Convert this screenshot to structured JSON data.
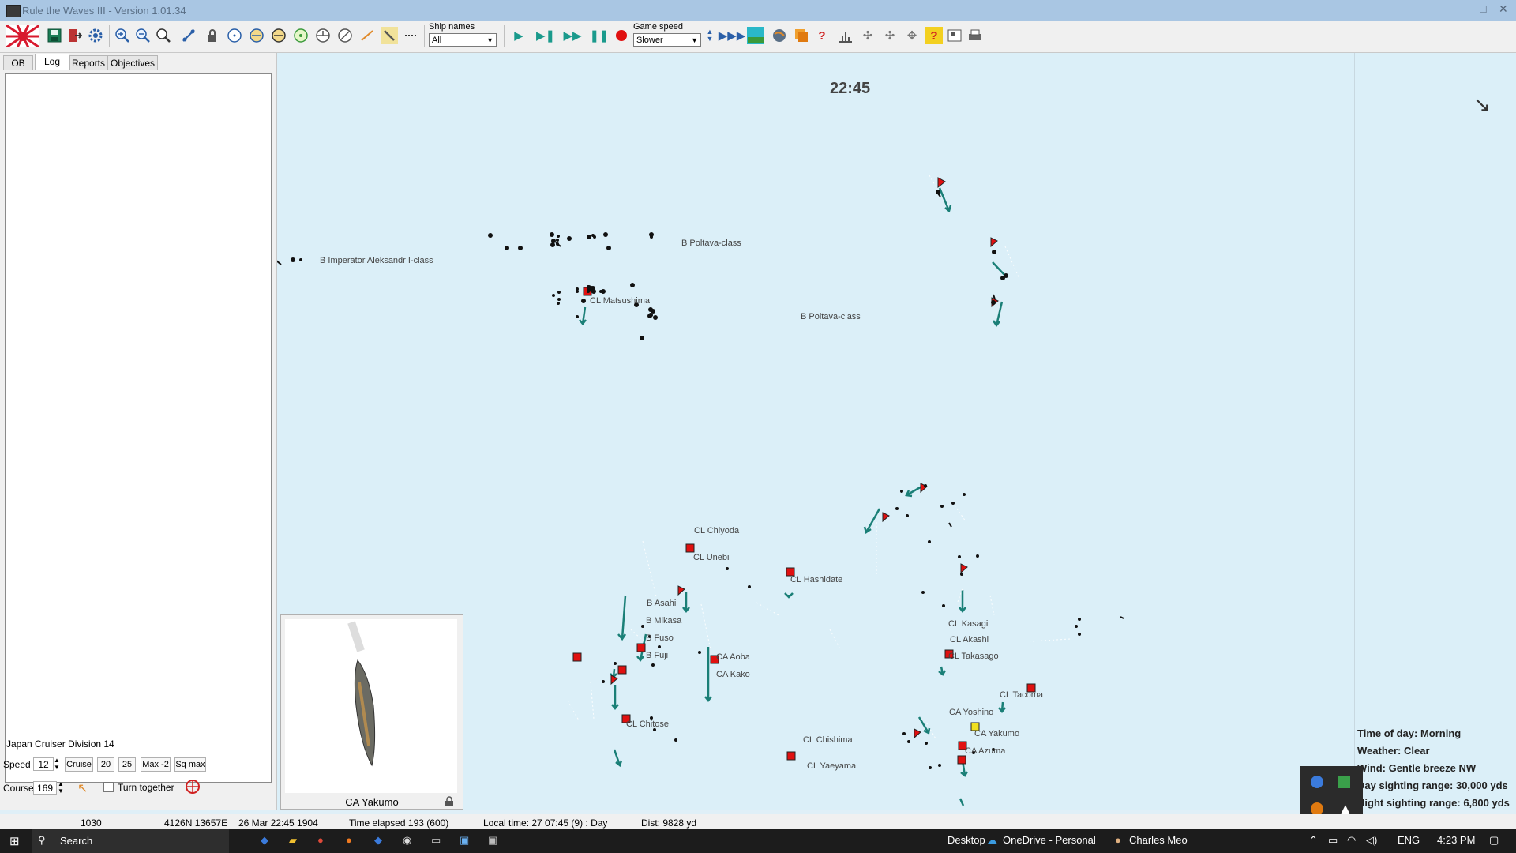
{
  "window": {
    "title": "Rule the Waves III - Version 1.01.34",
    "minimize_glyph": "□",
    "close_glyph": "✕"
  },
  "toolbar": {
    "icons": [
      "flag-japan-icon",
      "save-icon",
      "exit-icon",
      "gear-icon",
      "zoom-in-icon",
      "zoom-out-icon",
      "zoom-fit-icon",
      "link-icon",
      "lock-icon",
      "compass-icon",
      "range-ring-icon",
      "minus-ring-icon",
      "target-ring-icon",
      "cross-ring-icon",
      "slash-ring-icon",
      "line-icon",
      "pencil-icon",
      "dots-icon"
    ],
    "ship_names_label": "Ship names",
    "ship_names_value": "All",
    "game_speed_label": "Game speed",
    "game_speed_value": "Slower",
    "play_icons": [
      "play-icon",
      "step-icon",
      "fast-forward-icon",
      "pause-icon",
      "record-icon"
    ],
    "right_icons": [
      "fast-icon",
      "map-icon",
      "globe-icon",
      "layers-icon",
      "help-report-icon",
      "chart-icon",
      "formation-icon",
      "formation2-icon",
      "formation3-icon",
      "help-icon",
      "notes-icon",
      "print-icon"
    ],
    "accent_color": "#1a9a8c"
  },
  "left_panel": {
    "tabs": [
      "OB",
      "Log",
      "Reports",
      "Objectives"
    ],
    "active_tab": "Log",
    "division": "Japan Cruiser Division 14",
    "speed_label": "Speed",
    "speed_value": "12",
    "speed_buttons": [
      "Cruise",
      "20",
      "25",
      "Max -2",
      "Sq max"
    ],
    "course_label": "Course",
    "course_value": "169",
    "turn_together": "Turn together"
  },
  "ship_panel": {
    "ship_name": "CA Yakumo"
  },
  "map": {
    "time": "22:45",
    "labels": [
      {
        "id": "imperator",
        "text": "B Imperator Aleksandr I-class"
      },
      {
        "id": "poltava1",
        "text": "B Poltava-class"
      },
      {
        "id": "matsushima",
        "text": "CL Matsushima"
      },
      {
        "id": "poltava2",
        "text": "B Poltava-class"
      },
      {
        "id": "chiyoda",
        "text": "CL Chiyoda"
      },
      {
        "id": "unebi",
        "text": "CL Unebi"
      },
      {
        "id": "hashidate",
        "text": "CL Hashidate"
      },
      {
        "id": "asahi",
        "text": "B Asahi"
      },
      {
        "id": "mikasa",
        "text": "B Mikasa"
      },
      {
        "id": "fuso",
        "text": "B Fuso"
      },
      {
        "id": "fuji",
        "text": "B Fuji"
      },
      {
        "id": "aoba",
        "text": "CA Aoba"
      },
      {
        "id": "kako",
        "text": "CA Kako"
      },
      {
        "id": "chitose",
        "text": "CL Chitose"
      },
      {
        "id": "kasagi",
        "text": "CL Kasagi"
      },
      {
        "id": "akashi",
        "text": "CL Akashi"
      },
      {
        "id": "takasago",
        "text": "CL Takasago"
      },
      {
        "id": "tacoma",
        "text": "CL Tacoma"
      },
      {
        "id": "yoshino",
        "text": "CA Yoshino"
      },
      {
        "id": "yakumo",
        "text": "CA Yakumo"
      },
      {
        "id": "azuma",
        "text": "CA Azuma"
      },
      {
        "id": "chishima",
        "text": "CL Chishima"
      },
      {
        "id": "yaeyama",
        "text": "CL Yaeyama"
      }
    ]
  },
  "weather": {
    "time_of_day": "Time of day: Morning",
    "weather": "Weather: Clear",
    "wind": "Wind: Gentle breeze  NW",
    "day_range": "Day sighting range: 30,000 yds",
    "night_range": "Night sighting range: 6,800 yds"
  },
  "status_bar": {
    "id": "1030",
    "position": "4126N 13657E",
    "datetime": "26 Mar 22:45 1904",
    "elapsed": "Time elapsed 193 (600)",
    "local_time": "Local time: 27 07:45 (9) : Day",
    "distance": "Dist: 9828 yd"
  },
  "taskbar": {
    "search": "Search",
    "desktop": "Desktop",
    "onedrive": "OneDrive - Personal",
    "user": "Charles Meo",
    "lang": "ENG",
    "time": "4:23 PM"
  }
}
